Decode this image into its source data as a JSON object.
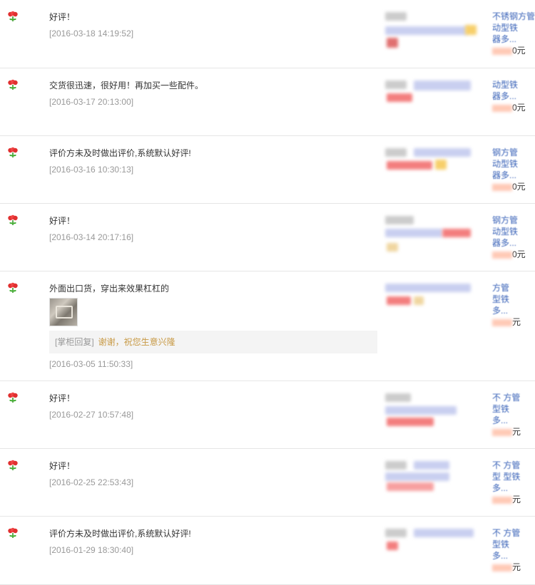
{
  "icons": {
    "flower": "red-flower-icon"
  },
  "reviews": [
    {
      "text": "好评！",
      "date": "[2016-03-18 14:19:52]",
      "prod_lines": [
        "不锈钢方管",
        "动型铁",
        "器多..."
      ],
      "price_suffix": "0元"
    },
    {
      "text": "交货很迅速，很好用！再加买一些配件。",
      "date": "[2016-03-17 20:13:00]",
      "prod_lines": [
        "",
        "动型铁",
        "器多..."
      ],
      "price_suffix": "0元"
    },
    {
      "text": "评价方未及时做出评价,系统默认好评!",
      "date": "[2016-03-16 10:30:13]",
      "prod_lines": [
        "钢方管",
        "动型铁",
        "器多..."
      ],
      "price_suffix": "0元"
    },
    {
      "text": "好评！",
      "date": "[2016-03-14 20:17:16]",
      "prod_lines": [
        "钢方管",
        "动型铁",
        "器多..."
      ],
      "price_suffix": "0元"
    },
    {
      "text": "外面出口货，穿出来效果杠杠的",
      "date": "[2016-03-05 11:50:33]",
      "reply_tag": "[掌柜回复]",
      "reply_text": "谢谢，祝您生意兴隆",
      "prod_lines": [
        "方管",
        "型铁",
        "多..."
      ],
      "price_suffix": "元"
    },
    {
      "text": "好评！",
      "date": "[2016-02-27 10:57:48]",
      "prod_lines": [
        "不 方管",
        "型铁",
        "多..."
      ],
      "price_suffix": "元"
    },
    {
      "text": "好评！",
      "date": "[2016-02-25 22:53:43]",
      "prod_lines": [
        "不 方管",
        "型 型铁",
        "多..."
      ],
      "price_suffix": "元"
    },
    {
      "text": "评价方未及时做出评价,系统默认好评!",
      "date": "[2016-01-29 18:30:40]",
      "prod_lines": [
        "不 方管",
        "型铁",
        "多..."
      ],
      "price_suffix": "元"
    }
  ]
}
